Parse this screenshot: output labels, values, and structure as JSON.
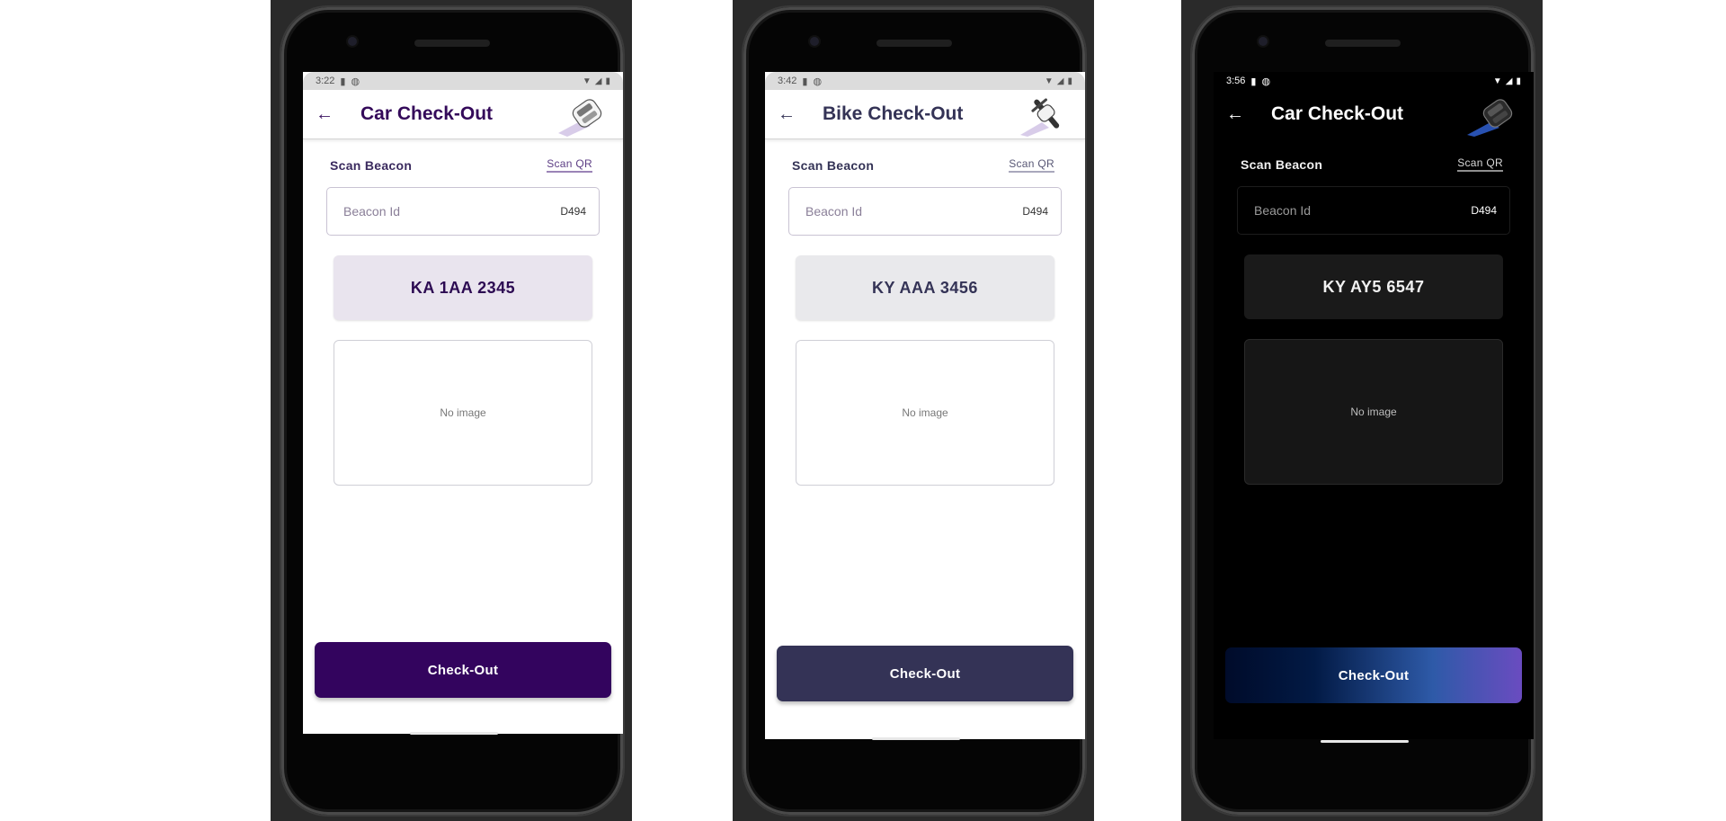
{
  "screens": [
    {
      "theme": "light",
      "status_time": "3:22",
      "title": "Car Check-Out",
      "vehicle_icon": "car-icon",
      "scan_beacon_label": "Scan Beacon",
      "scan_qr_label": "Scan QR",
      "beacon_placeholder": "Beacon Id",
      "beacon_value": "D494",
      "plate_number": "KA 1AA 2345",
      "image_placeholder": "No image",
      "checkout_label": "Check-Out",
      "colors": {
        "button": "#33045e",
        "accent": "#340a5a"
      }
    },
    {
      "theme": "light",
      "status_time": "3:42",
      "title": "Bike Check-Out",
      "vehicle_icon": "bike-icon",
      "scan_beacon_label": "Scan Beacon",
      "scan_qr_label": "Scan QR",
      "beacon_placeholder": "Beacon Id",
      "beacon_value": "D494",
      "plate_number": "KY AAA 3456",
      "image_placeholder": "No image",
      "checkout_label": "Check-Out",
      "colors": {
        "button": "#343356",
        "accent": "#343356"
      }
    },
    {
      "theme": "dark",
      "status_time": "3:56",
      "title": "Car Check-Out",
      "vehicle_icon": "car-icon",
      "scan_beacon_label": "Scan Beacon",
      "scan_qr_label": "Scan QR",
      "beacon_placeholder": "Beacon Id",
      "beacon_value": "D494",
      "plate_number": "KY AY5 6547",
      "image_placeholder": "No image",
      "checkout_label": "Check-Out",
      "colors": {
        "button_start": "#000b2a",
        "button_mid": "#2e5aa8",
        "button_end": "#6a4cc0"
      }
    }
  ]
}
